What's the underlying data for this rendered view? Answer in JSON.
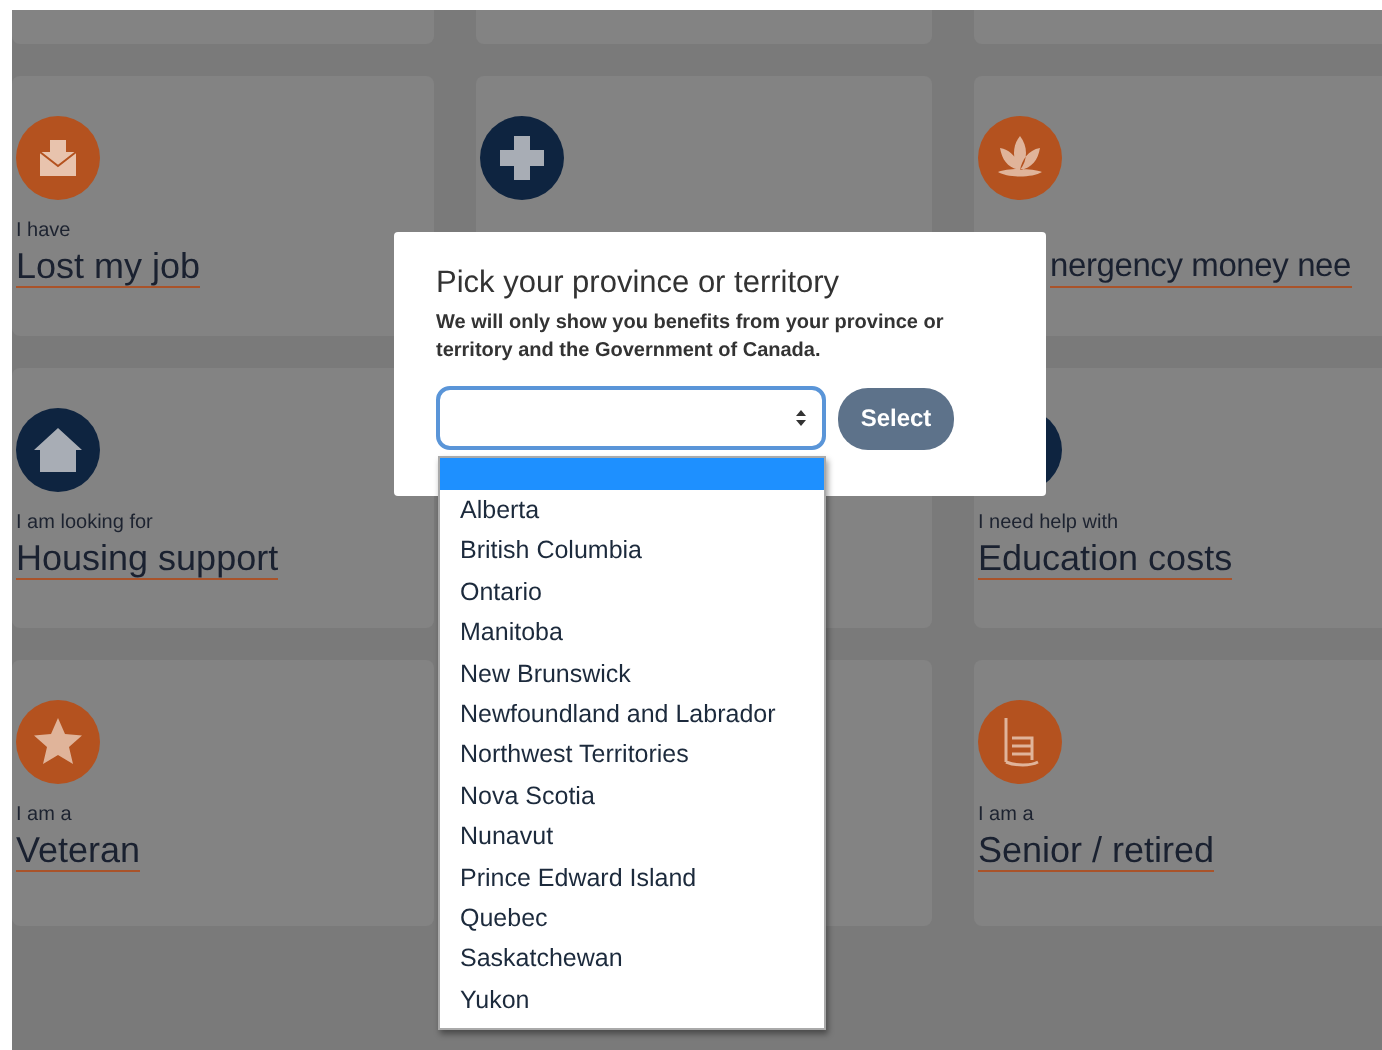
{
  "cards": [
    {
      "kind": "full",
      "color": "#b4521f",
      "label": "I have",
      "title": "Lost my job"
    },
    {
      "kind": "full",
      "color": "#0e2440"
    },
    {
      "kind": "covered",
      "color": "#b4521f",
      "title": "nergency money nee"
    },
    {
      "kind": "full",
      "color": "#0e2440",
      "label": "I am looking for",
      "title": "Housing support"
    },
    {
      "kind": "blank"
    },
    {
      "kind": "full",
      "color": "#0e2440",
      "label": "I need help with",
      "title": "Education costs"
    },
    {
      "kind": "full",
      "color": "#b4521f",
      "label": "I am a",
      "title": "Veteran"
    },
    {
      "kind": "blank"
    },
    {
      "kind": "full",
      "color": "#b4521f",
      "label": "I am a",
      "title": "Senior / retired"
    }
  ],
  "modal": {
    "title": "Pick your province or territory",
    "text": "We will only show you benefits from your province or territory and the Government of Canada.",
    "button": "Select",
    "dropdown": {
      "blank_option_selected": true,
      "options": [
        {
          "label": "Alberta",
          "selected": false
        },
        {
          "label": "British Columbia",
          "selected": false
        },
        {
          "label": "Ontario",
          "selected": false
        },
        {
          "label": "Manitoba",
          "selected": false
        },
        {
          "label": "New Brunswick",
          "selected": false
        },
        {
          "label": "Newfoundland and Labrador",
          "selected": false
        },
        {
          "label": "Northwest Territories",
          "selected": false
        },
        {
          "label": "Nova Scotia",
          "selected": false
        },
        {
          "label": "Nunavut",
          "selected": false
        },
        {
          "label": "Prince Edward Island",
          "selected": false
        },
        {
          "label": "Quebec",
          "selected": false
        },
        {
          "label": "Saskatchewan",
          "selected": false
        },
        {
          "label": "Yukon",
          "selected": false
        }
      ]
    }
  }
}
